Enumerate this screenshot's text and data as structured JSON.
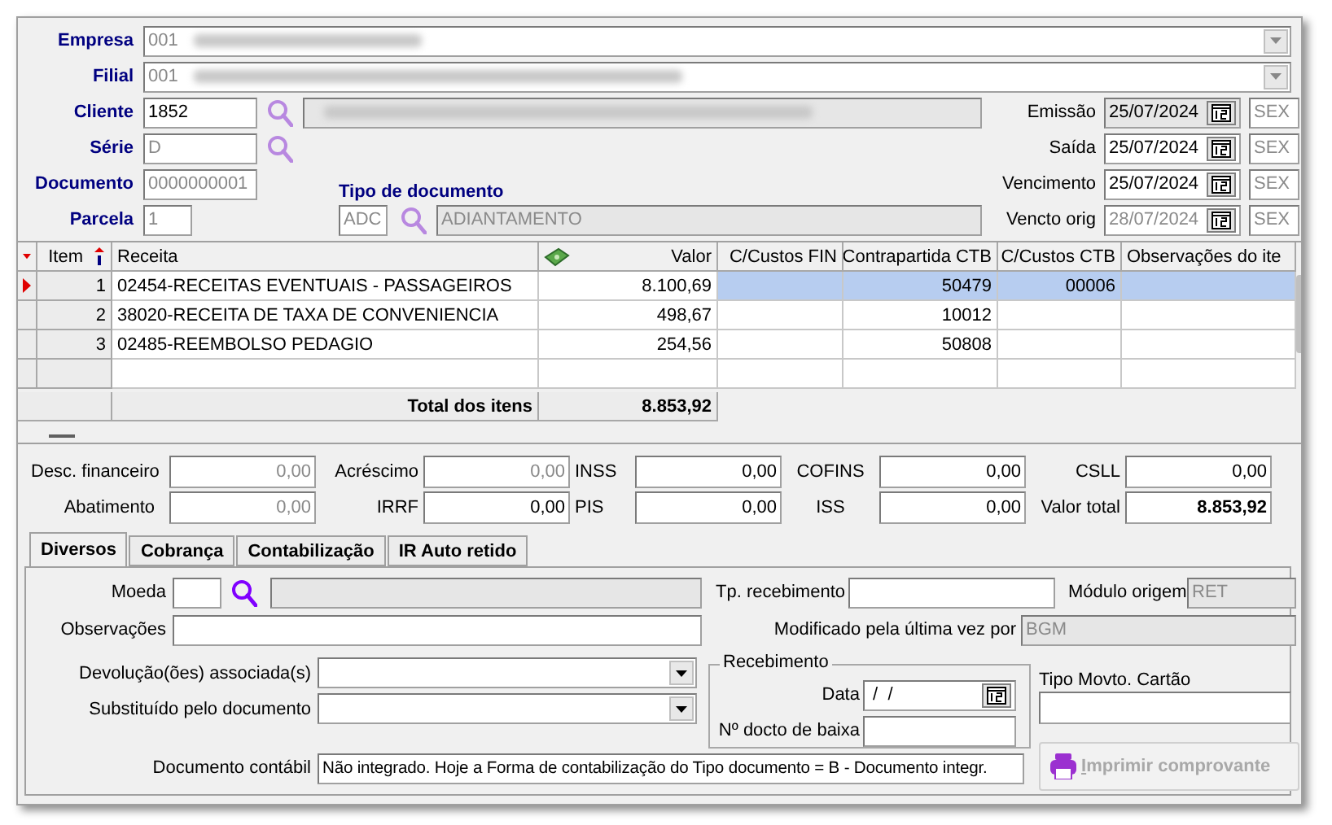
{
  "header": {
    "empresa": {
      "label": "Empresa",
      "code": "001",
      "disabled": true
    },
    "filial": {
      "label": "Filial",
      "code": "001",
      "disabled": true
    },
    "cliente": {
      "label": "Cliente",
      "value": "1852",
      "disabled": false
    },
    "serie": {
      "label": "Série",
      "value": "D",
      "disabled": true
    },
    "documento": {
      "label": "Documento",
      "value": "0000000001",
      "disabled": true
    },
    "parcela": {
      "label": "Parcela",
      "value": "1",
      "disabled": true
    },
    "tipo_documento": {
      "label": "Tipo de documento",
      "code": "ADC",
      "name": "ADIANTAMENTO",
      "disabled": true
    }
  },
  "dates": [
    {
      "label": "Emissão",
      "value": "25/07/2024",
      "weekday": "SEX",
      "readonly": true,
      "disabled": false
    },
    {
      "label": "Saída",
      "value": "25/07/2024",
      "weekday": "SEX",
      "readonly": false,
      "disabled": false
    },
    {
      "label": "Vencimento",
      "value": "25/07/2024",
      "weekday": "SEX",
      "readonly": false,
      "disabled": false
    },
    {
      "label": "Vencto orig",
      "value": "28/07/2024",
      "weekday": "SEX",
      "readonly": false,
      "disabled": true
    }
  ],
  "table": {
    "columns": [
      "Item",
      "Receita",
      "Valor",
      "C/Custos FIN",
      "Contrapartida CTB",
      "C/Custos CTB",
      "Observações do ite"
    ],
    "rows": [
      {
        "item": "1",
        "receita": "02454-RECEITAS EVENTUAIS - PASSAGEIROS",
        "valor": "8.100,69",
        "contrapartida": "50479",
        "cc_ctb": "00006",
        "selected": true
      },
      {
        "item": "2",
        "receita": "38020-RECEITA DE TAXA DE CONVENIENCIA",
        "valor": "498,67",
        "contrapartida": "10012",
        "selected": false
      },
      {
        "item": "3",
        "receita": "02485-REEMBOLSO PEDAGIO",
        "valor": "254,56",
        "contrapartida": "50808",
        "selected": false
      }
    ],
    "total": {
      "label": "Total dos itens",
      "value": "8.853,92"
    }
  },
  "totals": [
    [
      {
        "label": "Desc. financeiro",
        "value": "0,00",
        "kind": "disabled"
      },
      {
        "label": "Acréscimo",
        "value": "0,00",
        "kind": "disabled"
      },
      {
        "label": "INSS",
        "value": "0,00",
        "kind": "amount"
      },
      {
        "label": "COFINS",
        "value": "0,00",
        "kind": "amount"
      },
      {
        "label": "CSLL",
        "value": "0,00",
        "kind": "amount"
      }
    ],
    [
      {
        "label": "Abatimento",
        "value": "0,00",
        "kind": "disabled"
      },
      {
        "label": "IRRF",
        "value": "0,00",
        "kind": "amount"
      },
      {
        "label": "PIS",
        "value": "0,00",
        "kind": "amount"
      },
      {
        "label": "ISS",
        "value": "0,00",
        "kind": "amount"
      },
      {
        "label": "Valor total",
        "value": "8.853,92",
        "kind": "total"
      }
    ]
  ],
  "tabs": [
    {
      "label": "Diversos",
      "selected": true
    },
    {
      "label": "Cobrança",
      "selected": false
    },
    {
      "label": "Contabilização",
      "selected": false
    },
    {
      "label": "IR Auto retido",
      "selected": false
    }
  ],
  "diversos": {
    "moeda": {
      "label": "Moeda"
    },
    "observacoes": {
      "label": "Observações"
    },
    "tp_recebimento": {
      "label": "Tp. recebimento"
    },
    "modulo_origem": {
      "label": "Módulo origem",
      "value": "RET"
    },
    "modificado": {
      "label": "Modificado pela última vez por",
      "value": "BGM"
    },
    "devolucoes": {
      "label": "Devolução(ões) associada(s)"
    },
    "substituido": {
      "label": "Substituído pelo documento"
    },
    "recebimento": {
      "title": "Recebimento",
      "data_label": "Data",
      "data_value": " /  /",
      "docto_label": "Nº docto de baixa"
    },
    "tipo_movto": {
      "label": "Tipo Movto. Cartão"
    },
    "documento_contabil": {
      "label": "Documento contábil",
      "value": "Não integrado. Hoje a Forma de contabilização do Tipo documento = B - Documento integr."
    },
    "print_button": {
      "label": "Imprimir comprovante",
      "disabled": true
    }
  }
}
